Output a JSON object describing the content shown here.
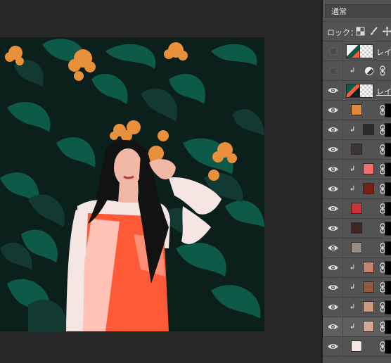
{
  "layers_panel": {
    "blend_mode": "通常",
    "lock_label": "ロック：",
    "lock_icons": [
      "transparency-lock-icon",
      "brush-lock-icon",
      "move-lock-icon"
    ]
  },
  "layers": [
    {
      "type": "image",
      "name": "レイヤ",
      "visible": false,
      "underline": false
    },
    {
      "type": "adjustment",
      "name": "",
      "visible": false,
      "clipped": true
    },
    {
      "type": "image",
      "name": "レイヤ",
      "visible": true,
      "underline": true
    },
    {
      "type": "fill",
      "color": "#e08a3c",
      "visible": true,
      "clipped": false
    },
    {
      "type": "fill",
      "color": "#2a2a2a",
      "visible": true,
      "clipped": true
    },
    {
      "type": "fill",
      "color": "#3b3536",
      "visible": true,
      "clipped": false
    },
    {
      "type": "fill",
      "color": "#f07070",
      "visible": true,
      "clipped": true
    },
    {
      "type": "fill",
      "color": "#7a1e12",
      "visible": true,
      "clipped": true
    },
    {
      "type": "fill",
      "color": "#c8333a",
      "visible": true,
      "clipped": false
    },
    {
      "type": "fill",
      "color": "#3e2722",
      "visible": true,
      "clipped": false
    },
    {
      "type": "fill",
      "color": "#9a8a86",
      "visible": true,
      "clipped": false
    },
    {
      "type": "fill",
      "color": "#c88270",
      "visible": true,
      "clipped": true
    },
    {
      "type": "fill",
      "color": "#8d5a40",
      "visible": true,
      "clipped": true
    },
    {
      "type": "fill",
      "color": "#cf9a82",
      "visible": true,
      "clipped": true
    },
    {
      "type": "fill",
      "color": "#d4a896",
      "visible": true,
      "clipped": true,
      "selected": true
    },
    {
      "type": "fill",
      "color": "#f6e6e3",
      "visible": true,
      "clipped": false
    }
  ],
  "artwork": {
    "background_color": "#0b1f1b",
    "leaf_colors": [
      "#0e5a48",
      "#123a32",
      "#0a2a24"
    ],
    "flower_color": "#e8903a",
    "dress_color": "#ff5a38",
    "dress_light": "#ffc2b4",
    "skin_color": "#f2b8a6",
    "hair_color": "#121212"
  }
}
